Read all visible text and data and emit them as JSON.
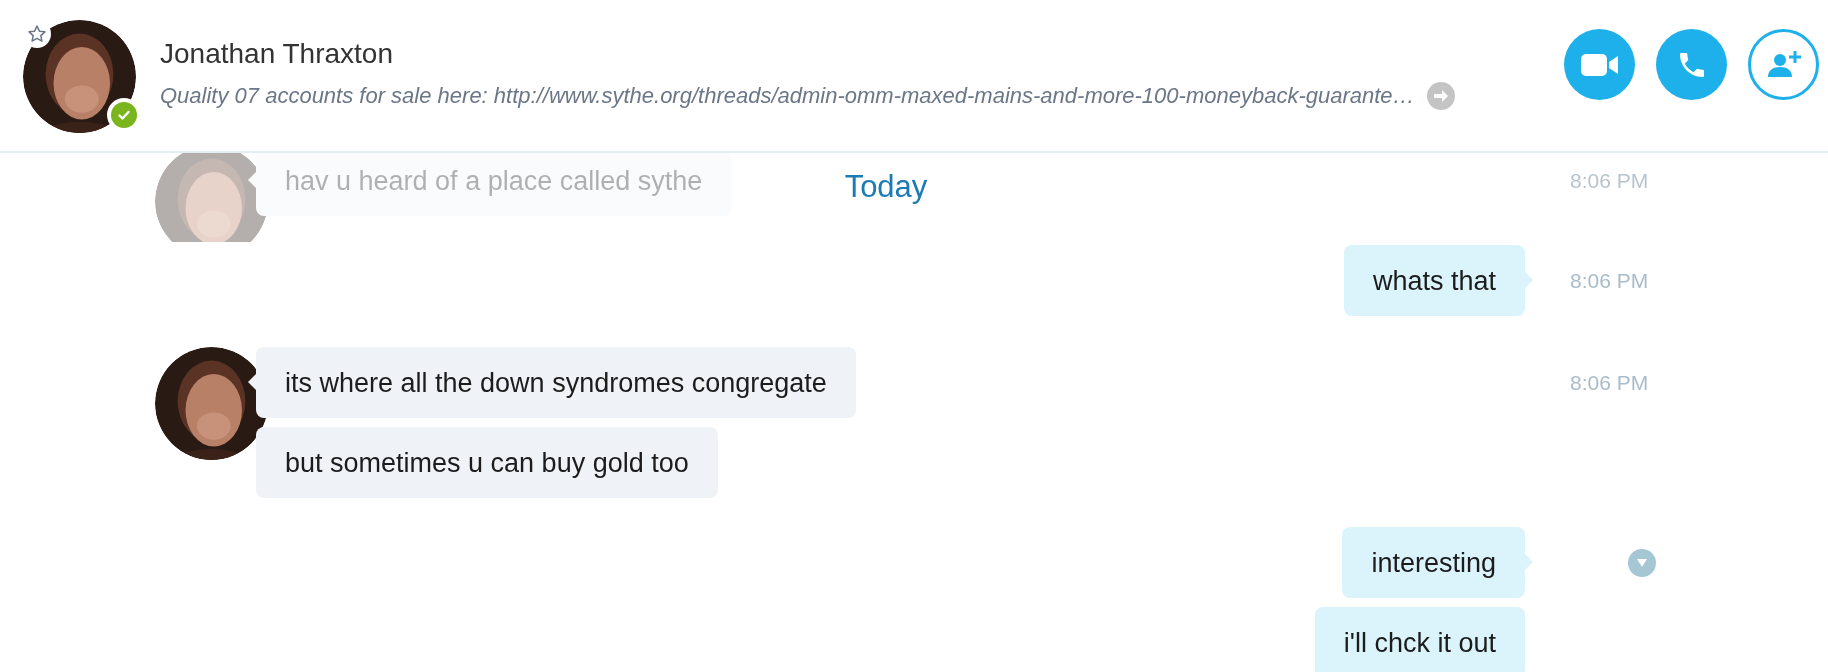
{
  "header": {
    "contact": {
      "name": "Jonathan Thraxton",
      "mood": "Quality 07 accounts for sale here: http://www.sythe.org/threads/admin-omm-maxed-mains-and-more-100-moneyback-guarante…",
      "favorite": false,
      "online": true
    },
    "buttons": [
      {
        "kind": "video"
      },
      {
        "kind": "call"
      },
      {
        "kind": "add_contact"
      }
    ]
  },
  "conversation": {
    "faded_message": {
      "incoming": true,
      "time": "8:06 PM",
      "bubbles": [
        "hav u heard of a place called sythe"
      ]
    },
    "date_divider": "Today",
    "groups": [
      {
        "incoming": false,
        "time": "8:06 PM",
        "bubbles": [
          "whats that"
        ],
        "menu": false
      },
      {
        "incoming": true,
        "time": "8:06 PM",
        "bubbles": [
          "its where all the down syndromes congregate",
          "but sometimes u can buy gold too"
        ],
        "menu": false
      },
      {
        "incoming": false,
        "bubbles": [
          "interesting",
          "i'll chck it out"
        ],
        "menu": true
      }
    ]
  }
}
